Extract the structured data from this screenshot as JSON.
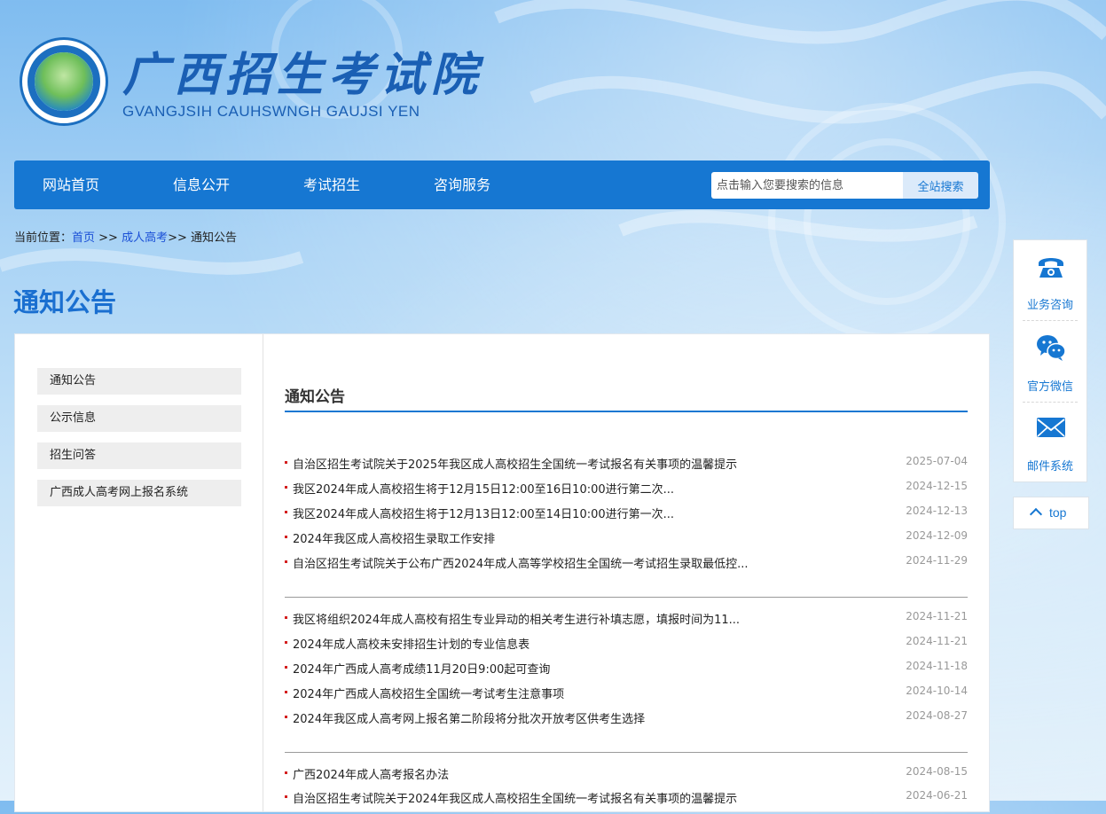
{
  "header": {
    "title": "广西招生考试院",
    "subtitle": "GVANGJSIH CAUHSWNGH GAUJSI YEN",
    "emblem_text": "广西招生考试院 GVANGJSIH CAUHSWNGH GAUJSI YEN"
  },
  "nav": {
    "items": [
      "网站首页",
      "信息公开",
      "考试招生",
      "咨询服务"
    ],
    "search_placeholder": "点击输入您要搜索的信息",
    "search_button": "全站搜索"
  },
  "breadcrumb": {
    "prefix": "当前位置：",
    "home": "首页",
    "sep1": " >> ",
    "section": "成人高考",
    "sep2": ">> ",
    "current": "通知公告"
  },
  "page_title": "通知公告",
  "sidebar": {
    "items": [
      "通知公告",
      "公示信息",
      "招生问答",
      "广西成人高考网上报名系统"
    ]
  },
  "content": {
    "title": "通知公告",
    "groups": [
      [
        {
          "title": "自治区招生考试院关于2025年我区成人高校招生全国统一考试报名有关事项的温馨提示",
          "date": "2025-07-04"
        },
        {
          "title": "我区2024年成人高校招生将于12月15日12:00至16日10:00进行第二次...",
          "date": "2024-12-15"
        },
        {
          "title": "我区2024年成人高校招生将于12月13日12:00至14日10:00进行第一次...",
          "date": "2024-12-13"
        },
        {
          "title": "2024年我区成人高校招生录取工作安排",
          "date": "2024-12-09"
        },
        {
          "title": "自治区招生考试院关于公布广西2024年成人高等学校招生全国统一考试招生录取最低控...",
          "date": "2024-11-29"
        }
      ],
      [
        {
          "title": "我区将组织2024年成人高校有招生专业异动的相关考生进行补填志愿，填报时间为11...",
          "date": "2024-11-21"
        },
        {
          "title": "2024年成人高校未安排招生计划的专业信息表",
          "date": "2024-11-21"
        },
        {
          "title": "2024年广西成人高考成绩11月20日9:00起可查询",
          "date": "2024-11-18"
        },
        {
          "title": "2024年广西成人高校招生全国统一考试考生注意事项",
          "date": "2024-10-14"
        },
        {
          "title": "2024年我区成人高考网上报名第二阶段将分批次开放考区供考生选择",
          "date": "2024-08-27"
        }
      ],
      [
        {
          "title": "广西2024年成人高考报名办法",
          "date": "2024-08-15"
        },
        {
          "title": "自治区招生考试院关于2024年我区成人高校招生全国统一考试报名有关事项的温馨提示",
          "date": "2024-06-21"
        }
      ]
    ]
  },
  "float_tools": {
    "items": [
      {
        "label": "业务咨询",
        "icon": "telephone-icon"
      },
      {
        "label": "官方微信",
        "icon": "wechat-icon"
      },
      {
        "label": "邮件系统",
        "icon": "envelope-icon"
      }
    ],
    "top_label": "top"
  },
  "colors": {
    "nav_bg": "#1677d2",
    "accent": "#1a6fd0",
    "bullet": "#d41f1f"
  }
}
